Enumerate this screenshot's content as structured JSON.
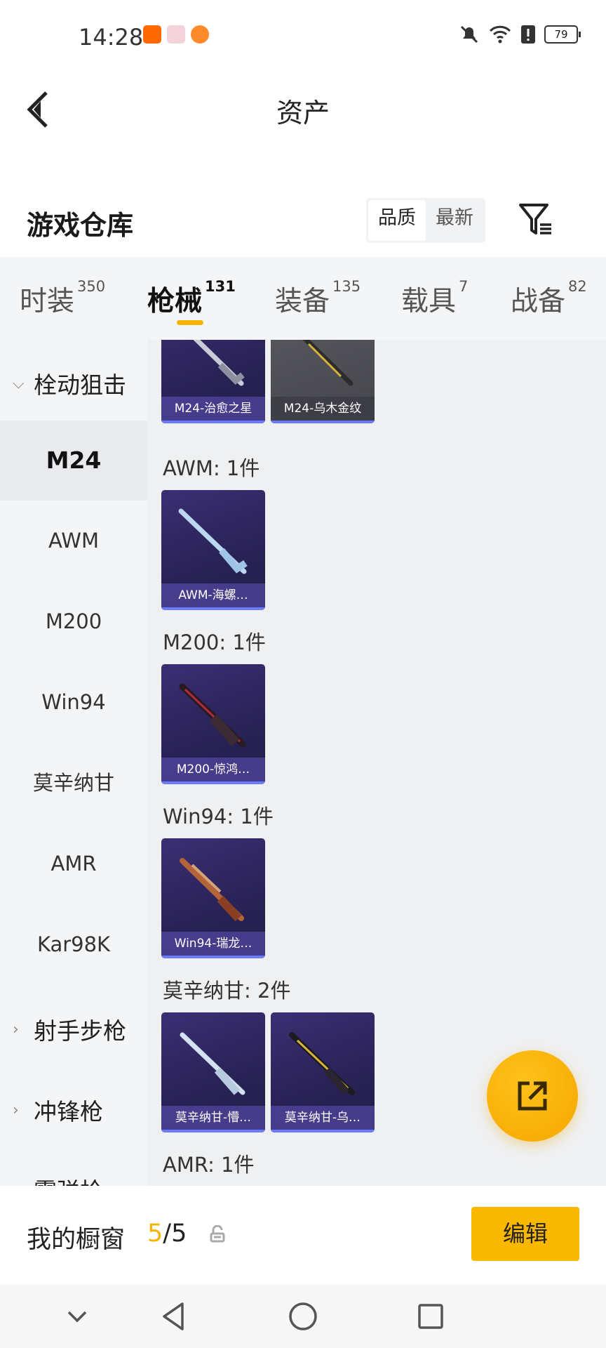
{
  "status_bar": {
    "time": "14:28",
    "battery": "79",
    "app_icon_colors": [
      "#ff6a00",
      "#e9445a",
      "#ff8a2a"
    ]
  },
  "header": {
    "title": "资产"
  },
  "section": {
    "title": "游戏仓库",
    "sort_options": [
      "品质",
      "最新"
    ]
  },
  "tabs": [
    {
      "label": "时装",
      "count": "350"
    },
    {
      "label": "枪械",
      "count": "131"
    },
    {
      "label": "装备",
      "count": "135"
    },
    {
      "label": "载具",
      "count": "7"
    },
    {
      "label": "战备",
      "count": "82"
    }
  ],
  "sidebar": {
    "categories": [
      "栓动狙击",
      "射手步枪",
      "冲锋枪",
      "霰弹枪"
    ],
    "subitems": [
      "M24",
      "AWM",
      "M200",
      "Win94",
      "莫辛纳甘",
      "AMR",
      "Kar98K"
    ]
  },
  "content": {
    "top_items": [
      "M24-治愈之星",
      "M24-乌木金纹"
    ],
    "groups": [
      {
        "label": "AWM: 1件",
        "items": [
          "AWM-海螺…"
        ]
      },
      {
        "label": "M200: 1件",
        "items": [
          "M200-惊鸿…"
        ]
      },
      {
        "label": "Win94: 1件",
        "items": [
          "Win94-瑞龙…"
        ]
      },
      {
        "label": "莫辛纳甘: 2件",
        "items": [
          "莫辛纳甘-懵…",
          "莫辛纳甘-乌…"
        ]
      },
      {
        "label": "AMR: 1件",
        "items": []
      }
    ]
  },
  "footer": {
    "showcase_label": "我的橱窗",
    "count_current": "5",
    "count_total": "/5",
    "edit_label": "编辑"
  },
  "colors": {
    "accent": "#f5b400",
    "card_bg": "#2a2358"
  }
}
